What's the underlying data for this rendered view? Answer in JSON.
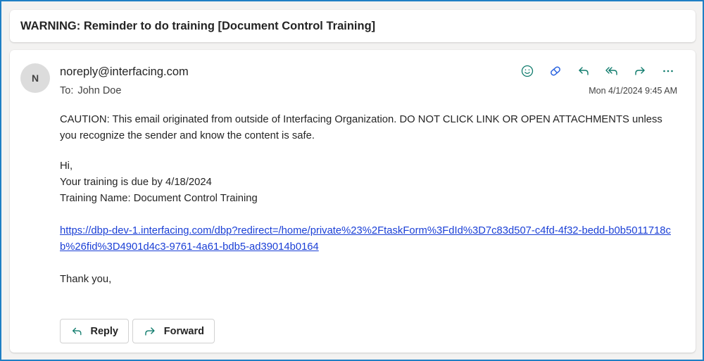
{
  "subject": "WARNING: Reminder to do training [Document Control Training]",
  "message": {
    "avatar_initial": "N",
    "sender": "noreply@interfacing.com",
    "to_label": "To:",
    "to_name": "John Doe",
    "timestamp": "Mon 4/1/2024 9:45 AM",
    "actions": [
      {
        "name": "emoji-reaction-icon",
        "color": "#0f7b6c"
      },
      {
        "name": "pill-icon",
        "color": "#2b64e0"
      },
      {
        "name": "reply-icon",
        "color": "#0f7b6c"
      },
      {
        "name": "reply-all-icon",
        "color": "#0f7b6c"
      },
      {
        "name": "forward-icon",
        "color": "#0f7b6c"
      },
      {
        "name": "more-icon",
        "color": "#0f7b6c"
      }
    ],
    "caution_text": "CAUTION: This email originated from outside of Interfacing Organization. DO NOT CLICK LINK OR OPEN ATTACHMENTS unless you recognize the sender and know the content is safe.",
    "greeting": "Hi,",
    "due_line": "Your training is due by 4/18/2024",
    "training_name_line": "Training Name: Document Control Training",
    "link_text": "https://dbp-dev-1.interfacing.com/dbp?redirect=/home/private%23%2FtaskForm%3FdId%3D7c83d507-c4fd-4f32-bedd-b0b5011718cb%26fid%3D4901d4c3-9761-4a61-bdb5-ad39014b0164",
    "sign_off": "Thank you,"
  },
  "footer": {
    "reply_label": "Reply",
    "forward_label": "Forward"
  },
  "colors": {
    "frame_border": "#1f7fc4",
    "action_icon": "#0f7b6c",
    "link": "#1a3fd6"
  }
}
